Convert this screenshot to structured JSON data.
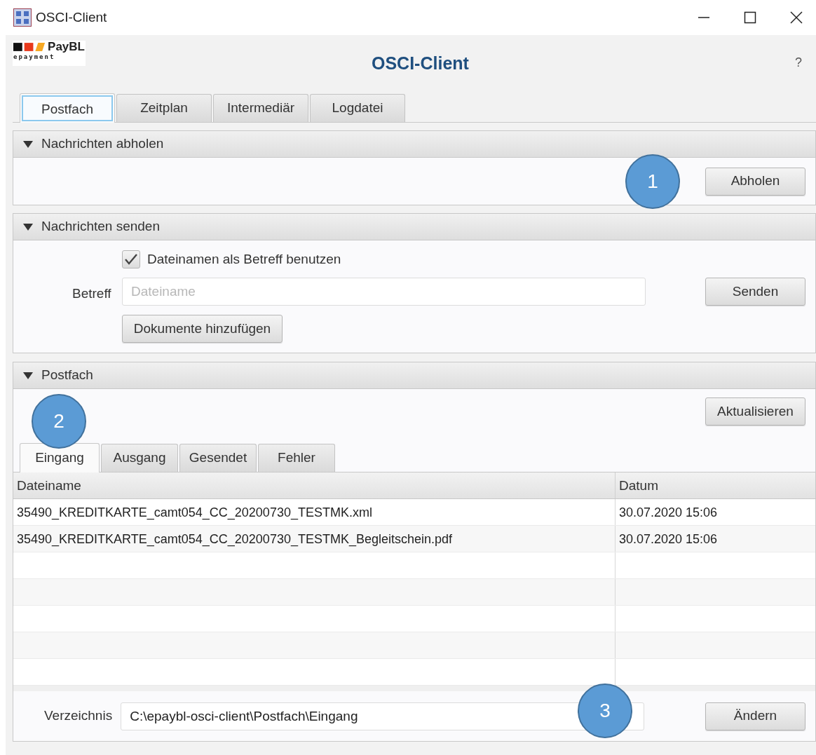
{
  "window": {
    "title": "OSCI-Client"
  },
  "header": {
    "logo_text": "PayBL",
    "logo_subtext": "epayment",
    "title": "OSCI-Client",
    "help": "?"
  },
  "tabs": [
    {
      "label": "Postfach",
      "selected": true
    },
    {
      "label": "Zeitplan",
      "selected": false
    },
    {
      "label": "Intermediär",
      "selected": false
    },
    {
      "label": "Logdatei",
      "selected": false
    }
  ],
  "fetch_section": {
    "title": "Nachrichten abholen",
    "expanded": true,
    "button": "Abholen"
  },
  "send_section": {
    "title": "Nachrichten senden",
    "expanded": true,
    "checkbox": {
      "label": "Dateinamen als Betreff benutzen",
      "checked": true
    },
    "subject_label": "Betreff",
    "subject_field": {
      "placeholder": "Dateiname"
    },
    "add_button": "Dokumente hinzufügen",
    "send_button": "Senden"
  },
  "mailbox_section": {
    "title": "Postfach",
    "expanded": true,
    "refresh_button": "Aktualisieren",
    "tabs": [
      {
        "label": "Eingang",
        "selected": true
      },
      {
        "label": "Ausgang",
        "selected": false
      },
      {
        "label": "Gesendet",
        "selected": false
      },
      {
        "label": "Fehler",
        "selected": false
      }
    ],
    "table": {
      "columns": [
        "Dateiname",
        "Datum"
      ],
      "rows": [
        [
          "35490_KREDITKARTE_camt054_CC_20200730_TESTMK.xml",
          "30.07.2020 15:06"
        ],
        [
          "35490_KREDITKARTE_camt054_CC_20200730_TESTMK_Begleitschein.pdf",
          "30.07.2020 15:06"
        ]
      ]
    },
    "directory_label": "Verzeichnis",
    "directory_field": {
      "value": "C:\\epaybl-osci-client\\Postfach\\Eingang"
    },
    "change_button": "Ändern"
  },
  "callouts": [
    {
      "label": "1"
    },
    {
      "label": "2"
    },
    {
      "label": "3"
    }
  ]
}
